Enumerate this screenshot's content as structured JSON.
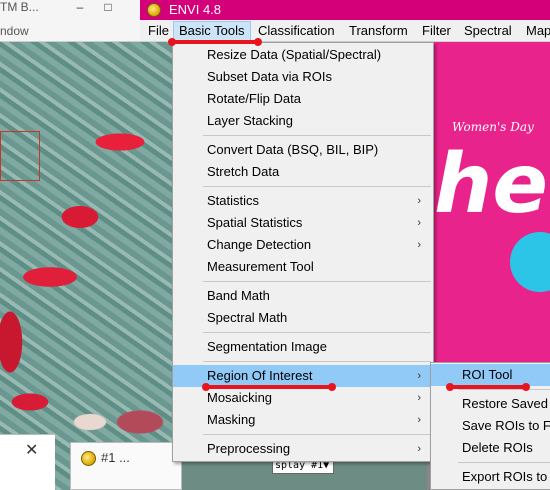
{
  "background_window": {
    "title": "TM B...",
    "subtitle": "ndow",
    "minimize": "–",
    "maximize": "□"
  },
  "envi": {
    "title": "ENVI 4.8",
    "menubar": [
      "File",
      "Basic Tools",
      "Classification",
      "Transform",
      "Filter",
      "Spectral",
      "Map"
    ]
  },
  "basic_tools_menu": {
    "items": [
      {
        "label": "Resize Data (Spatial/Spectral)"
      },
      {
        "label": "Subset Data via ROIs"
      },
      {
        "label": "Rotate/Flip Data"
      },
      {
        "label": "Layer Stacking"
      },
      {
        "label": "Convert Data (BSQ, BIL, BIP)"
      },
      {
        "label": "Stretch Data"
      },
      {
        "label": "Statistics"
      },
      {
        "label": "Spatial Statistics"
      },
      {
        "label": "Change Detection"
      },
      {
        "label": "Measurement Tool"
      },
      {
        "label": "Band Math"
      },
      {
        "label": "Spectral Math"
      },
      {
        "label": "Segmentation Image"
      },
      {
        "label": "Region Of Interest"
      },
      {
        "label": "Mosaicking"
      },
      {
        "label": "Masking"
      },
      {
        "label": "Preprocessing"
      }
    ],
    "submenu_arrow": "›"
  },
  "roi_submenu": {
    "items": [
      "ROI Tool",
      "Restore Saved",
      "Save ROIs to Fi",
      "Delete ROIs",
      "Export ROIs to"
    ]
  },
  "poster": {
    "caption": "Women's Day",
    "big_text": "he P"
  },
  "bottom": {
    "close_glyph": "✕",
    "display_title": "#1 ...",
    "display_combo": "splay #1▼"
  },
  "colors": {
    "title_bar": "#d4007a",
    "menu_bg": "#f0f0f0",
    "highlight": "#91c9f7",
    "annotation": "#e8141e",
    "poster": "#e8248c"
  }
}
